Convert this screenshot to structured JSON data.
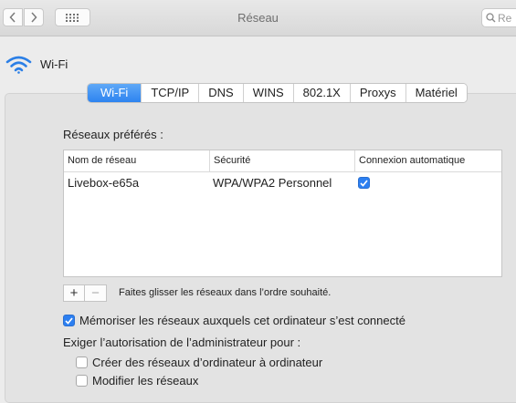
{
  "window": {
    "title": "Réseau"
  },
  "search": {
    "placeholder": "Re"
  },
  "interface": {
    "name": "Wi-Fi"
  },
  "tabs": [
    {
      "label": "Wi-Fi",
      "active": true
    },
    {
      "label": "TCP/IP",
      "active": false
    },
    {
      "label": "DNS",
      "active": false
    },
    {
      "label": "WINS",
      "active": false
    },
    {
      "label": "802.1X",
      "active": false
    },
    {
      "label": "Proxys",
      "active": false
    },
    {
      "label": "Matériel",
      "active": false
    }
  ],
  "preferred": {
    "label": "Réseaux préférés :",
    "columns": [
      "Nom de réseau",
      "Sécurité",
      "Connexion automatique"
    ],
    "rows": [
      {
        "name": "Livebox-e65a",
        "security": "WPA/WPA2 Personnel",
        "auto_connect": true
      }
    ],
    "add_symbol": "+",
    "remove_symbol": "−",
    "hint": "Faites glisser les réseaux dans l’ordre souhaité."
  },
  "options": {
    "remember": {
      "label": "Mémoriser les réseaux auxquels cet ordinateur s’est connecté",
      "checked": true
    },
    "admin_label": "Exiger l’autorisation de l’administrateur pour :",
    "create_computer_networks": {
      "label": "Créer des réseaux d’ordinateur à ordinateur",
      "checked": false
    },
    "modify_networks": {
      "label": "Modifier les réseaux",
      "checked": false
    }
  },
  "colors": {
    "accent": "#2c7ff1",
    "wifi_icon": "#2b7fe6"
  },
  "icons": [
    "chevron-left-icon",
    "chevron-right-icon",
    "grid-icon",
    "search-icon",
    "wifi-icon",
    "checkmark-icon"
  ]
}
